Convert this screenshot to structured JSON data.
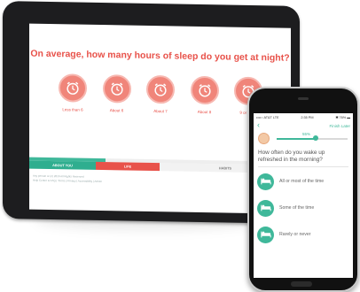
{
  "tablet": {
    "question": "On average, how many hours of sleep do you get at night?",
    "options": [
      "Less than 6",
      "About 6",
      "About 7",
      "About 8",
      "9 or more"
    ],
    "progress_fraction": 0.29,
    "tabs": [
      "ABOUT YOU",
      "LIFE",
      "HABITS"
    ],
    "footer": [
      "Any person or (c) 2016 All Rights Reserved",
      "Help Center & FAQ | Terms | Privacy | Accessibility | Admin"
    ],
    "colors": {
      "accent": "#e8524a",
      "teal": "#3fb89a"
    }
  },
  "phone": {
    "status": {
      "carrier": "••••○ AT&T LTE",
      "time": "2:35 PM",
      "battery": "✱ 76% ▬"
    },
    "back": "‹",
    "finish": "Finish Later",
    "progress_label": "55%",
    "progress_fraction": 0.55,
    "question": "How often do you wake up refreshed in the morning?",
    "answers": [
      "All or most of the time",
      "Some of the time",
      "Rarely or never"
    ]
  }
}
